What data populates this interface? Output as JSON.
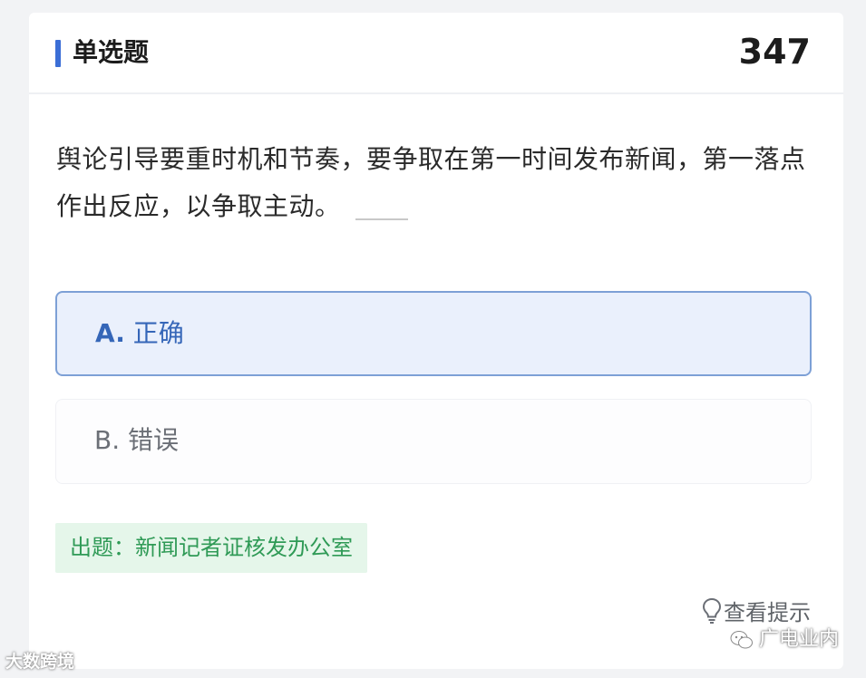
{
  "header": {
    "title": "单选题",
    "number": "347"
  },
  "question": {
    "text": "舆论引导要重时机和节奏，要争取在第一时间发布新闻，第一落点作出反应，以争取主动。"
  },
  "options": [
    {
      "letter": "A.",
      "label": "正确",
      "selected": true
    },
    {
      "letter": "B.",
      "label": "错误",
      "selected": false
    }
  ],
  "source": {
    "text": "出题：新闻记者证核发办公室"
  },
  "hint": {
    "label": "查看提示",
    "icon": "lightbulb-icon"
  },
  "watermarks": {
    "right": "广电业内",
    "left": "大数跨境"
  },
  "colors": {
    "accent": "#3b6ed6",
    "selected_bg": "#eaf0fc",
    "selected_border": "#7da0d6",
    "source_text": "#2f9a56",
    "source_bg": "#e5f6ea"
  }
}
